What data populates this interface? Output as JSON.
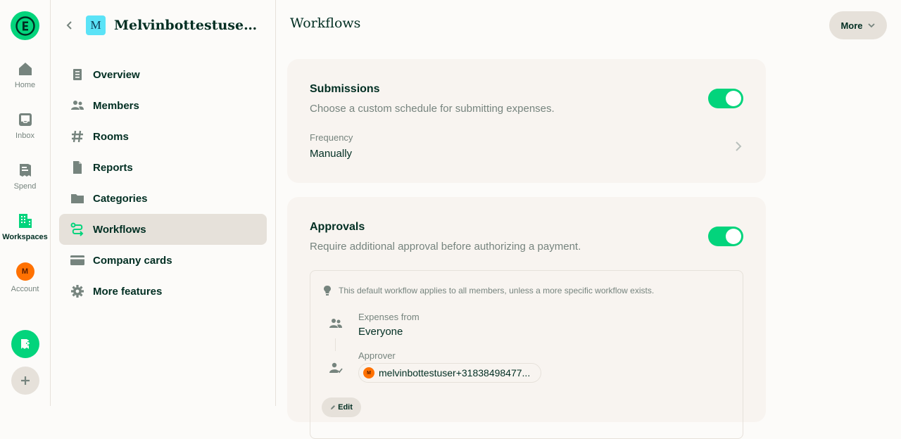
{
  "rail": {
    "items": [
      {
        "label": "Home",
        "icon": "home-icon"
      },
      {
        "label": "Inbox",
        "icon": "inbox-icon"
      },
      {
        "label": "Spend",
        "icon": "receipt-icon"
      },
      {
        "label": "Workspaces",
        "icon": "building-icon"
      },
      {
        "label": "Account",
        "icon": "avatar",
        "avatar_initial": "M"
      }
    ]
  },
  "sidebar": {
    "workspace_initial": "M",
    "workspace_name": "Melvinbottestuser+3...",
    "items": [
      {
        "label": "Overview",
        "icon": "document-icon"
      },
      {
        "label": "Members",
        "icon": "users-icon"
      },
      {
        "label": "Rooms",
        "icon": "hashtag-icon"
      },
      {
        "label": "Reports",
        "icon": "file-icon"
      },
      {
        "label": "Categories",
        "icon": "folder-icon"
      },
      {
        "label": "Workflows",
        "icon": "workflow-icon"
      },
      {
        "label": "Company cards",
        "icon": "credit-card-icon"
      },
      {
        "label": "More features",
        "icon": "gear-icon"
      }
    ]
  },
  "main": {
    "title": "Workflows",
    "more_label": "More",
    "submissions": {
      "title": "Submissions",
      "subtitle": "Choose a custom schedule for submitting expenses.",
      "frequency_label": "Frequency",
      "frequency_value": "Manually"
    },
    "approvals": {
      "title": "Approvals",
      "subtitle": "Require additional approval before authorizing a payment.",
      "hint": "This default workflow applies to all members, unless a more specific workflow exists.",
      "expenses_from_label": "Expenses from",
      "expenses_from_value": "Everyone",
      "approver_label": "Approver",
      "approver_initial": "M",
      "approver_value": "melvinbottestuser+31838498477...",
      "edit_label": "Edit"
    }
  },
  "colors": {
    "accent": "#03D47C",
    "text": "#002E22",
    "muted": "#76847E",
    "border": "#E6E1DA",
    "card": "#F8F4F0",
    "avatar": "#FF7101"
  }
}
